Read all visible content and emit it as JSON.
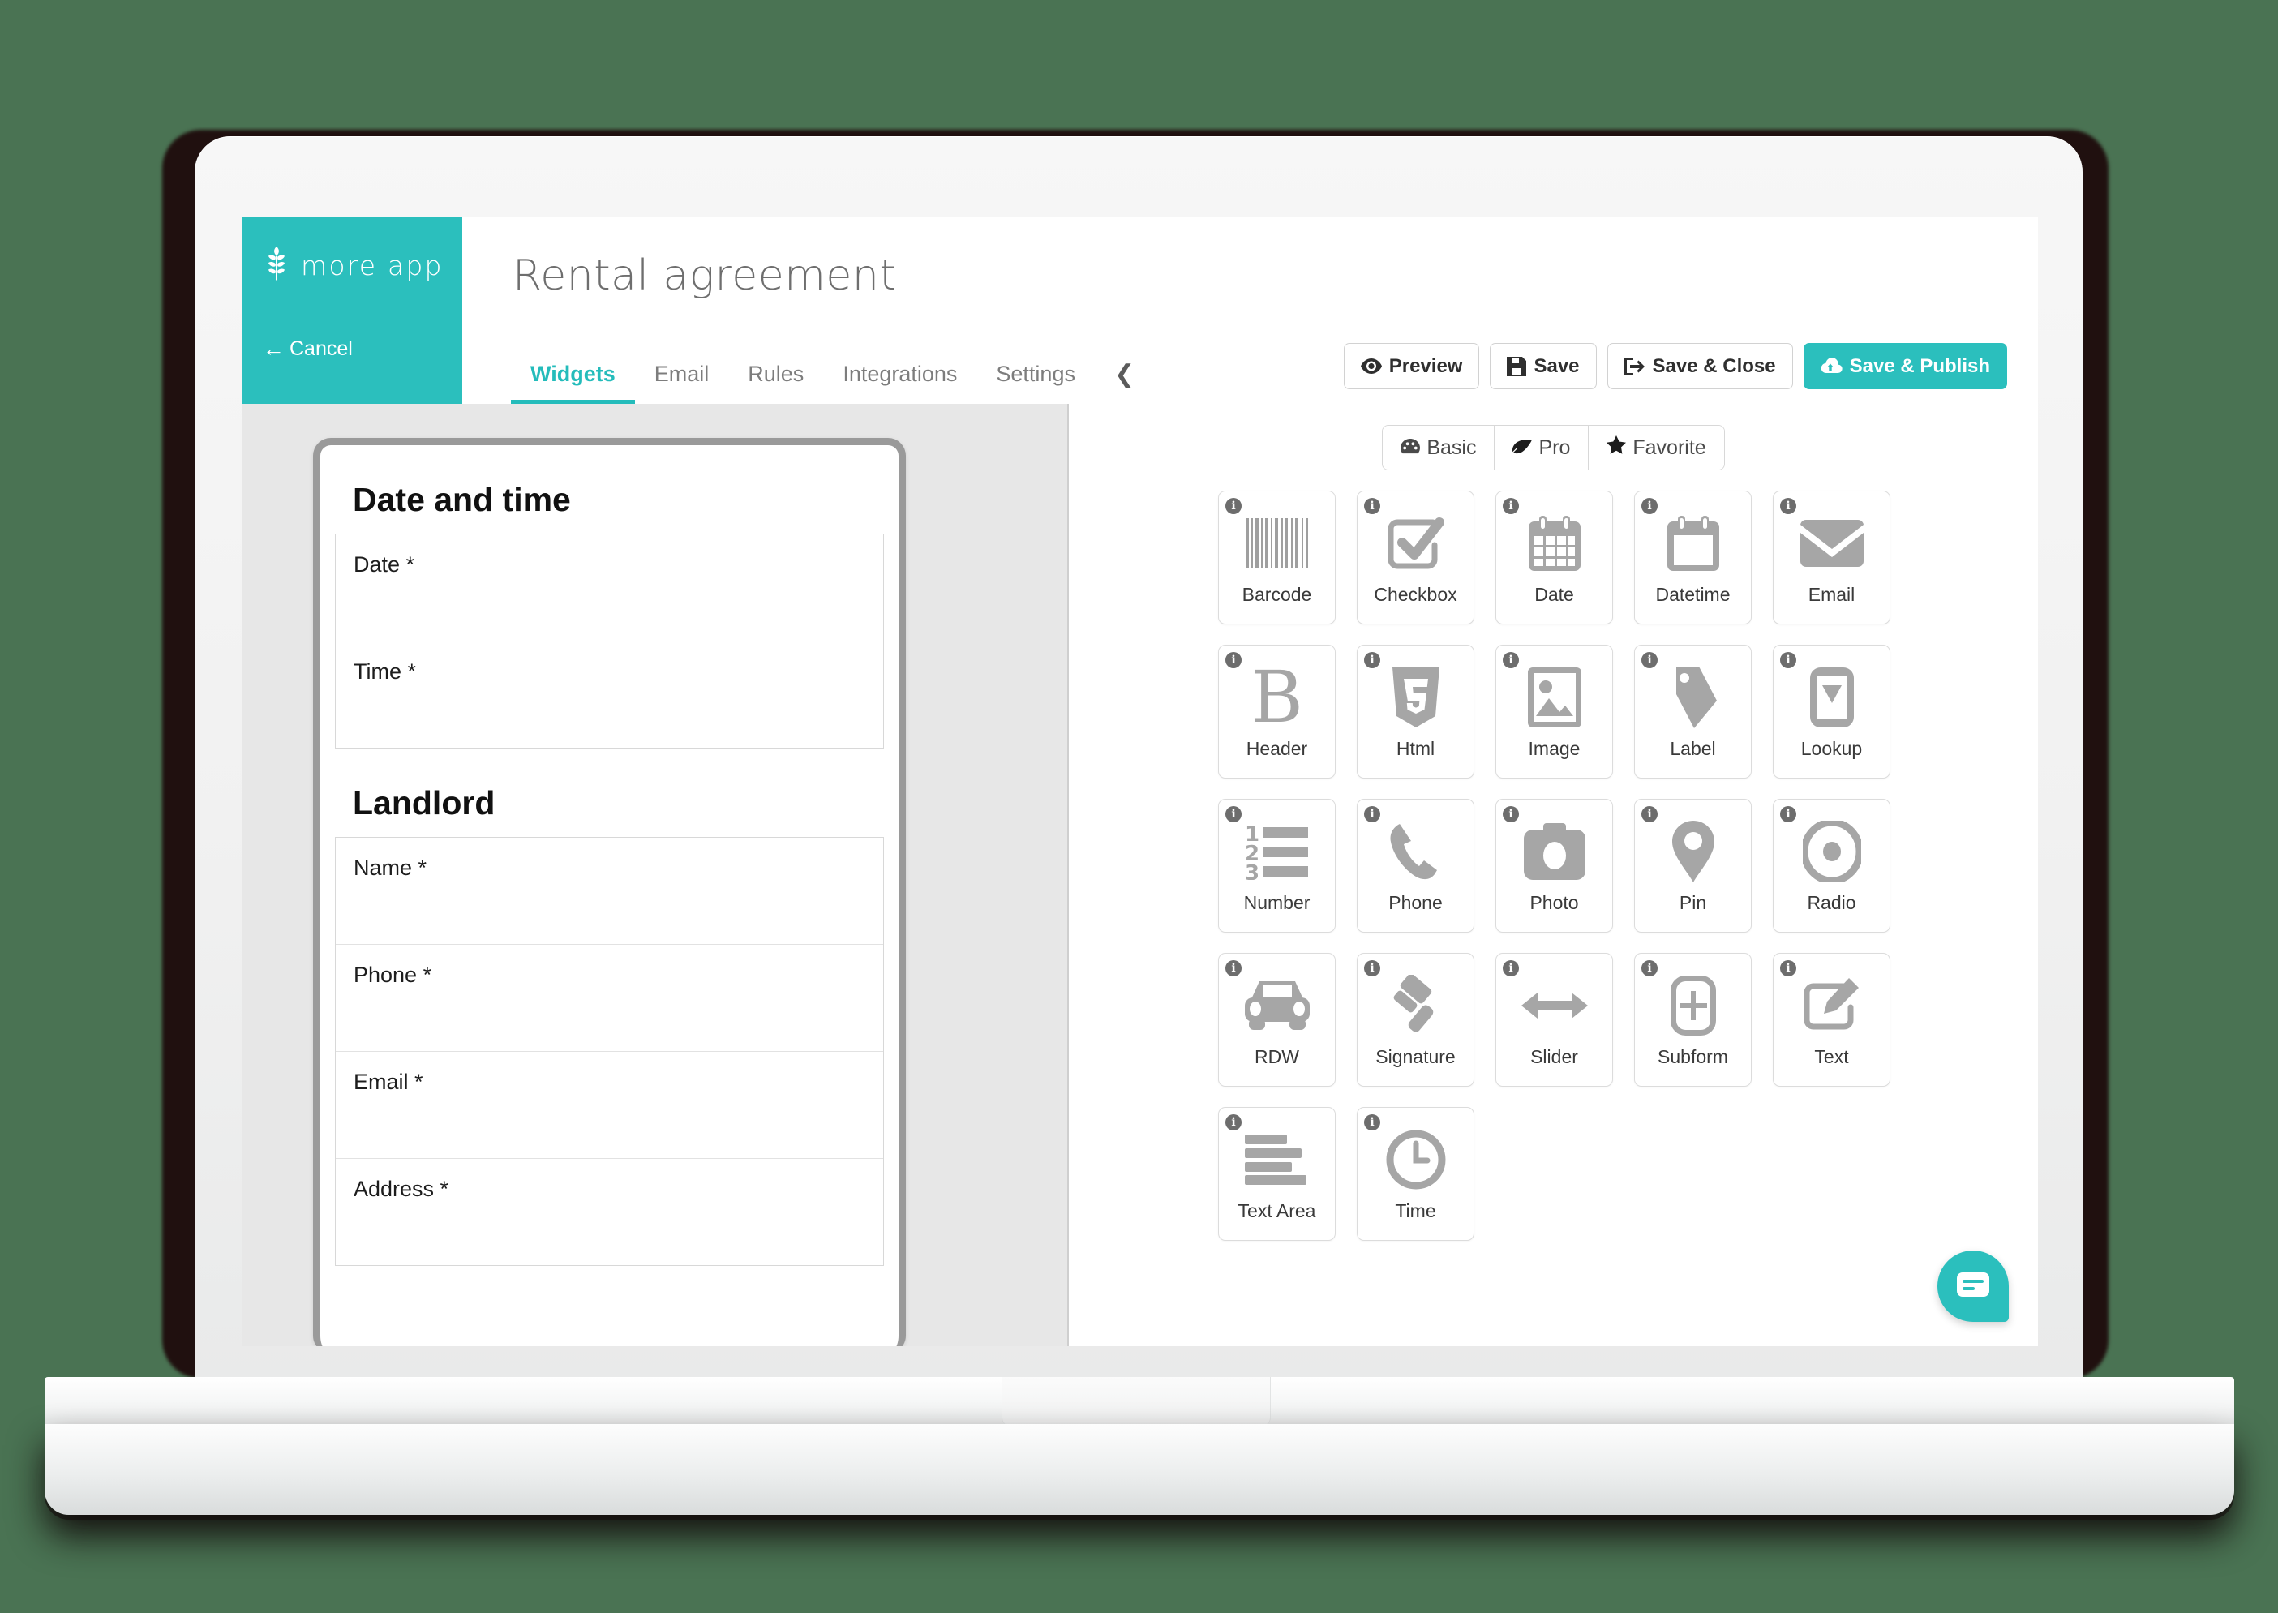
{
  "theme": {
    "background": "#4a7353",
    "accent": "#2bbfbd",
    "tab_active": "#24bcbb",
    "icon_grey": "#a6a6a6",
    "canvas_grey": "#e7e7e7"
  },
  "brand": {
    "logo_icon": "wheat-icon",
    "name": "more app",
    "cancel_label": "Cancel",
    "cancel_icon": "arrow-left-icon"
  },
  "header": {
    "title": "Rental agreement"
  },
  "tabs": [
    {
      "label": "Widgets",
      "active": true
    },
    {
      "label": "Email",
      "active": false
    },
    {
      "label": "Rules",
      "active": false
    },
    {
      "label": "Integrations",
      "active": false
    },
    {
      "label": "Settings",
      "active": false
    }
  ],
  "tabs_collapse_icon": "chevron-left-icon",
  "toolbar": [
    {
      "label": "Preview",
      "icon": "eye-icon",
      "primary": false
    },
    {
      "label": "Save",
      "icon": "floppy-disk-icon",
      "primary": false
    },
    {
      "label": "Save & Close",
      "icon": "sign-out-icon",
      "primary": false
    },
    {
      "label": "Save & Publish",
      "icon": "cloud-upload-icon",
      "primary": true
    }
  ],
  "form_preview": {
    "sections": [
      {
        "title": "Date and time",
        "fields": [
          {
            "label": "Date *"
          },
          {
            "label": "Time *"
          }
        ]
      },
      {
        "title": "Landlord",
        "fields": [
          {
            "label": "Name *"
          },
          {
            "label": "Phone *"
          },
          {
            "label": "Email *"
          },
          {
            "label": "Address *"
          }
        ]
      }
    ]
  },
  "widget_filters": [
    {
      "label": "Basic",
      "icon": "puzzle-icon",
      "active": true
    },
    {
      "label": "Pro",
      "icon": "leaf-icon",
      "active": false
    },
    {
      "label": "Favorite",
      "icon": "star-icon",
      "active": false
    }
  ],
  "widgets": [
    {
      "label": "Barcode",
      "icon": "barcode-icon"
    },
    {
      "label": "Checkbox",
      "icon": "checkbox-icon"
    },
    {
      "label": "Date",
      "icon": "calendar-icon"
    },
    {
      "label": "Datetime",
      "icon": "calendar-blank-icon"
    },
    {
      "label": "Email",
      "icon": "envelope-icon"
    },
    {
      "label": "Header",
      "icon": "bold-b-icon"
    },
    {
      "label": "Html",
      "icon": "html5-shield-icon"
    },
    {
      "label": "Image",
      "icon": "image-icon"
    },
    {
      "label": "Label",
      "icon": "tag-icon"
    },
    {
      "label": "Lookup",
      "icon": "dropdown-icon"
    },
    {
      "label": "Number",
      "icon": "ordered-list-icon"
    },
    {
      "label": "Phone",
      "icon": "phone-icon"
    },
    {
      "label": "Photo",
      "icon": "camera-icon"
    },
    {
      "label": "Pin",
      "icon": "map-pin-icon"
    },
    {
      "label": "Radio",
      "icon": "radio-button-icon"
    },
    {
      "label": "RDW",
      "icon": "car-icon"
    },
    {
      "label": "Signature",
      "icon": "gavel-icon"
    },
    {
      "label": "Slider",
      "icon": "arrows-horizontal-icon"
    },
    {
      "label": "Subform",
      "icon": "plus-box-icon"
    },
    {
      "label": "Text",
      "icon": "pencil-square-icon"
    },
    {
      "label": "Text Area",
      "icon": "text-lines-icon"
    },
    {
      "label": "Time",
      "icon": "clock-icon"
    }
  ],
  "chat": {
    "icon": "chat-bubble-icon"
  }
}
